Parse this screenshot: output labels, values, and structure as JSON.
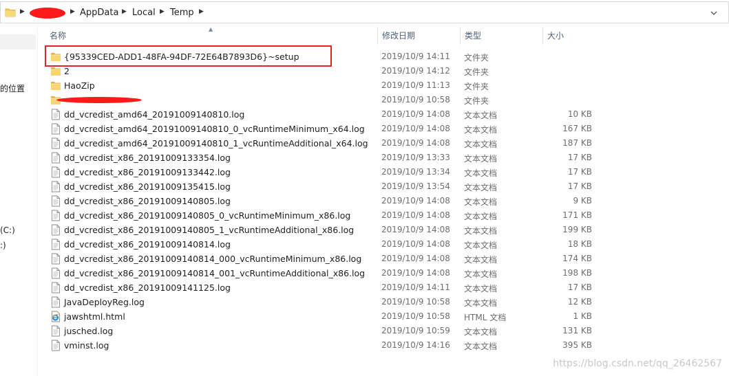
{
  "address": {
    "crumbs": [
      "AppData",
      "Local",
      "Temp"
    ],
    "separator_glyph": "▶"
  },
  "nav": {
    "items": [
      "的位置",
      "(C:)",
      ":)"
    ]
  },
  "columns": {
    "name": "名称",
    "date": "修改日期",
    "type": "类型",
    "size": "大小"
  },
  "rows": [
    {
      "name": "{95339CED-ADD1-48FA-94DF-72E64B7893D6}~setup",
      "date": "2019/10/9 14:11",
      "type": "文件夹",
      "size": "",
      "icon": "folder-icon"
    },
    {
      "name": "2",
      "date": "2019/10/9 14:12",
      "type": "文件夹",
      "size": "",
      "icon": "folder-icon"
    },
    {
      "name": "HaoZip",
      "date": "2019/10/9 11:13",
      "type": "文件夹",
      "size": "",
      "icon": "folder-icon"
    },
    {
      "name": "",
      "date": "2019/10/9 10:58",
      "type": "文件夹",
      "size": "",
      "icon": "folder-icon",
      "redacted": true
    },
    {
      "name": "dd_vcredist_amd64_20191009140810.log",
      "date": "2019/10/9 14:08",
      "type": "文本文档",
      "size": "10 KB",
      "icon": "text-file-icon"
    },
    {
      "name": "dd_vcredist_amd64_20191009140810_0_vcRuntimeMinimum_x64.log",
      "date": "2019/10/9 14:08",
      "type": "文本文档",
      "size": "167 KB",
      "icon": "text-file-icon"
    },
    {
      "name": "dd_vcredist_amd64_20191009140810_1_vcRuntimeAdditional_x64.log",
      "date": "2019/10/9 14:08",
      "type": "文本文档",
      "size": "187 KB",
      "icon": "text-file-icon"
    },
    {
      "name": "dd_vcredist_x86_20191009133354.log",
      "date": "2019/10/9 13:33",
      "type": "文本文档",
      "size": "17 KB",
      "icon": "text-file-icon"
    },
    {
      "name": "dd_vcredist_x86_20191009133442.log",
      "date": "2019/10/9 13:34",
      "type": "文本文档",
      "size": "17 KB",
      "icon": "text-file-icon"
    },
    {
      "name": "dd_vcredist_x86_20191009135415.log",
      "date": "2019/10/9 13:54",
      "type": "文本文档",
      "size": "17 KB",
      "icon": "text-file-icon"
    },
    {
      "name": "dd_vcredist_x86_20191009140805.log",
      "date": "2019/10/9 14:08",
      "type": "文本文档",
      "size": "9 KB",
      "icon": "text-file-icon"
    },
    {
      "name": "dd_vcredist_x86_20191009140805_0_vcRuntimeMinimum_x86.log",
      "date": "2019/10/9 14:08",
      "type": "文本文档",
      "size": "171 KB",
      "icon": "text-file-icon"
    },
    {
      "name": "dd_vcredist_x86_20191009140805_1_vcRuntimeAdditional_x86.log",
      "date": "2019/10/9 14:08",
      "type": "文本文档",
      "size": "199 KB",
      "icon": "text-file-icon"
    },
    {
      "name": "dd_vcredist_x86_20191009140814.log",
      "date": "2019/10/9 14:08",
      "type": "文本文档",
      "size": "18 KB",
      "icon": "text-file-icon"
    },
    {
      "name": "dd_vcredist_x86_20191009140814_000_vcRuntimeMinimum_x86.log",
      "date": "2019/10/9 14:08",
      "type": "文本文档",
      "size": "174 KB",
      "icon": "text-file-icon"
    },
    {
      "name": "dd_vcredist_x86_20191009140814_001_vcRuntimeAdditional_x86.log",
      "date": "2019/10/9 14:08",
      "type": "文本文档",
      "size": "198 KB",
      "icon": "text-file-icon"
    },
    {
      "name": "dd_vcredist_x86_20191009141125.log",
      "date": "2019/10/9 14:11",
      "type": "文本文档",
      "size": "17 KB",
      "icon": "text-file-icon"
    },
    {
      "name": "JavaDeployReg.log",
      "date": "2019/10/9 10:58",
      "type": "文本文档",
      "size": "12 KB",
      "icon": "text-file-icon"
    },
    {
      "name": "jawshtml.html",
      "date": "2019/10/9 10:58",
      "type": "HTML 文档",
      "size": "1 KB",
      "icon": "html-file-icon"
    },
    {
      "name": "jusched.log",
      "date": "2019/10/9 10:59",
      "type": "文本文档",
      "size": "131 KB",
      "icon": "text-file-icon"
    },
    {
      "name": "vminst.log",
      "date": "2019/10/9 14:16",
      "type": "文本文档",
      "size": "395 KB",
      "icon": "text-file-icon"
    }
  ],
  "watermark": "https://blog.csdn.net/qq_26462567",
  "colors": {
    "highlight_border": "#e0242b",
    "redaction": "#ff1a1a",
    "folder": "#f3c55a",
    "header_text": "#4c607a"
  }
}
